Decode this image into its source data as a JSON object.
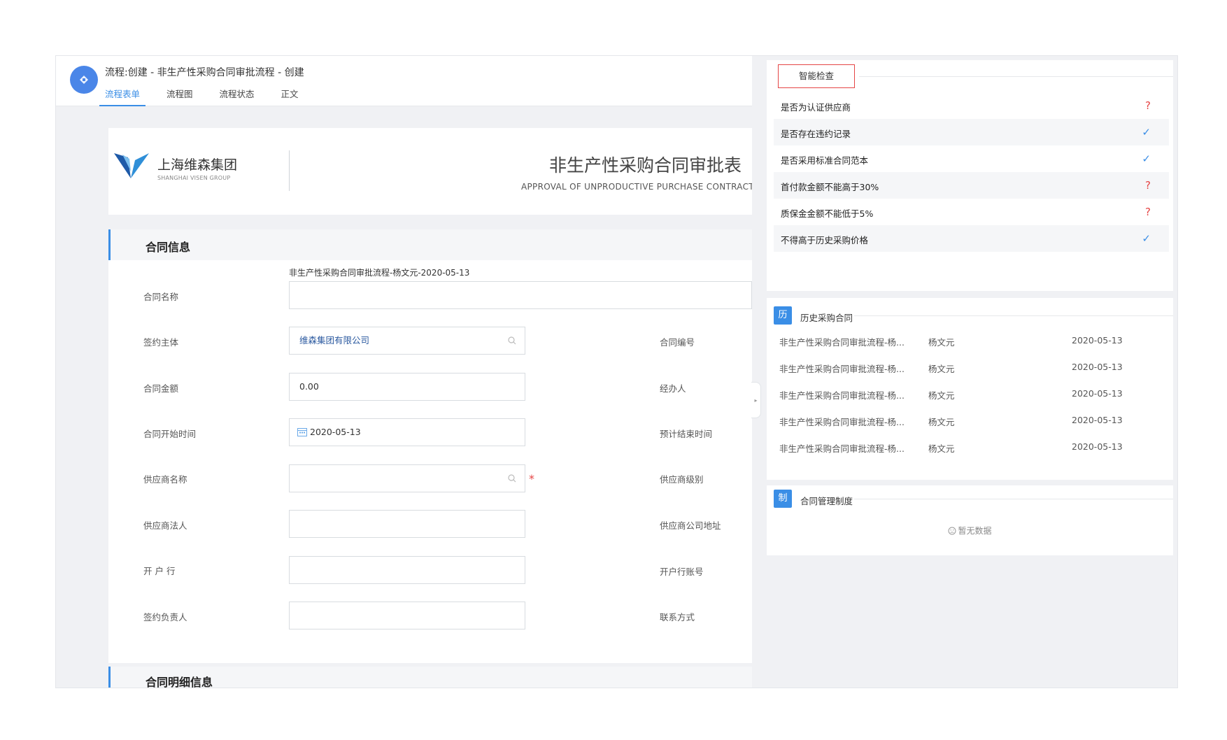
{
  "header": {
    "title": "流程:创建 - 非生产性采购合同审批流程 - 创建",
    "tabs": [
      {
        "label": "流程表单",
        "active": true
      },
      {
        "label": "流程图",
        "active": false
      },
      {
        "label": "流程状态",
        "active": false
      },
      {
        "label": "正文",
        "active": false
      }
    ]
  },
  "doc": {
    "company_name": "上海维森集团",
    "company_en": "SHANGHAI VISEN GROUP",
    "title": "非生产性采购合同审批表",
    "subtitle": "APPROVAL OF UNPRODUCTIVE PURCHASE CONTRACT F"
  },
  "contract_section": {
    "title": "合同信息",
    "name_above_value": "非生产性采购合同审批流程-杨文元-2020-05-13",
    "fields": {
      "contract_name": {
        "label": "合同名称",
        "value": ""
      },
      "signing_party": {
        "label": "签约主体",
        "value": "维森集团有限公司"
      },
      "contract_no": {
        "label": "合同编号"
      },
      "amount": {
        "label": "合同金额",
        "value": "0.00"
      },
      "handler": {
        "label": "经办人"
      },
      "start_date": {
        "label": "合同开始时间",
        "value": "2020-05-13"
      },
      "end_date": {
        "label": "预计结束时间"
      },
      "supplier_name": {
        "label": "供应商名称",
        "value": "",
        "required_mark": "*"
      },
      "supplier_level": {
        "label": "供应商级别"
      },
      "supplier_legal": {
        "label": "供应商法人",
        "value": ""
      },
      "supplier_address": {
        "label": "供应商公司地址"
      },
      "bank": {
        "label": "开 户 行",
        "value": ""
      },
      "bank_account": {
        "label": "开户行账号"
      },
      "signer": {
        "label": "签约负责人",
        "value": ""
      },
      "contact": {
        "label": "联系方式"
      }
    }
  },
  "detail_section": {
    "title": "合同明细信息"
  },
  "smart_check": {
    "button_label": "智能检查",
    "items": [
      {
        "label": "是否为认证供应商",
        "status": "?"
      },
      {
        "label": "是否存在违约记录",
        "status": "✓"
      },
      {
        "label": "是否采用标准合同范本",
        "status": "✓"
      },
      {
        "label": "首付款金额不能高于30%",
        "status": "?"
      },
      {
        "label": "质保金金额不能低于5%",
        "status": "?"
      },
      {
        "label": "不得高于历史采购价格",
        "status": "✓"
      }
    ]
  },
  "history": {
    "badge": "历",
    "title": "历史采购合同",
    "rows": [
      {
        "name": "非生产性采购合同审批流程-杨...",
        "person": "杨文元",
        "date": "2020-05-13"
      },
      {
        "name": "非生产性采购合同审批流程-杨...",
        "person": "杨文元",
        "date": "2020-05-13"
      },
      {
        "name": "非生产性采购合同审批流程-杨...",
        "person": "杨文元",
        "date": "2020-05-13"
      },
      {
        "name": "非生产性采购合同审批流程-杨...",
        "person": "杨文元",
        "date": "2020-05-13"
      },
      {
        "name": "非生产性采购合同审批流程-杨...",
        "person": "杨文元",
        "date": "2020-05-13"
      }
    ]
  },
  "policy": {
    "badge": "制",
    "title": "合同管理制度",
    "empty_text": "暂无数据"
  },
  "colors": {
    "accent": "#3a8ee6",
    "danger": "#e54545"
  }
}
